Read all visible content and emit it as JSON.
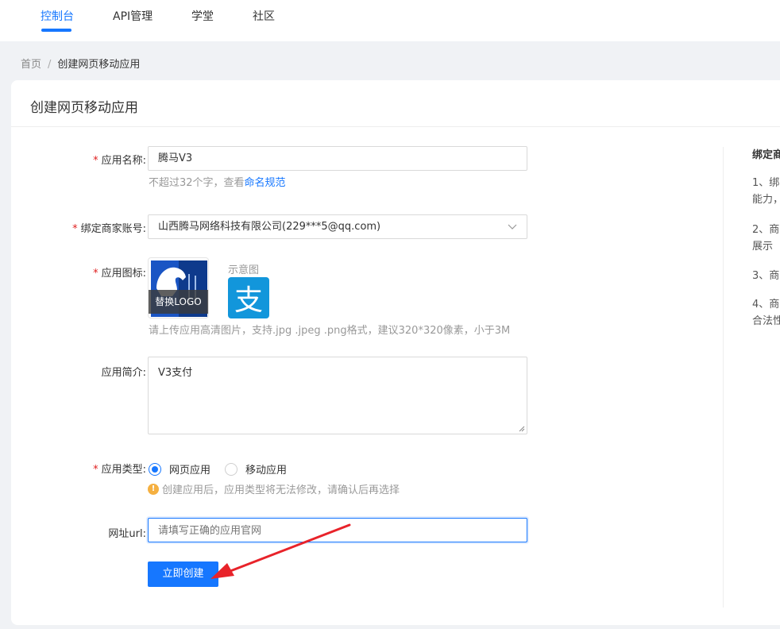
{
  "nav": {
    "items": [
      "控制台",
      "API管理",
      "学堂",
      "社区"
    ],
    "active_index": 0
  },
  "breadcrumb": {
    "home": "首页",
    "separator": "/",
    "current": "创建网页移动应用"
  },
  "page_title": "创建网页移动应用",
  "form": {
    "app_name": {
      "label": "应用名称:",
      "value": "腾马V3",
      "hint_prefix": "不超过32个字，查看",
      "hint_link": "命名规范"
    },
    "merchant": {
      "label": "绑定商家账号:",
      "value": "山西腾马网络科技有限公司(229***5@qq.com)"
    },
    "icon": {
      "label": "应用图标:",
      "replace_label": "替换LOGO",
      "sample_label": "示意图",
      "sample_glyph": "支",
      "hint": "请上传应用高清图片，支持.jpg .jpeg .png格式，建议320*320像素，小于3M"
    },
    "intro": {
      "label": "应用简介:",
      "value": "V3支付"
    },
    "type": {
      "label": "应用类型:",
      "options": [
        "网页应用",
        "移动应用"
      ],
      "selected": "网页应用",
      "warning_glyph": "!",
      "warning": "创建应用后，应用类型将无法修改，请确认后再选择"
    },
    "url": {
      "label": "网址url:",
      "placeholder": "请填写正确的应用官网",
      "value": ""
    },
    "submit_label": "立即创建"
  },
  "side_panel": {
    "title": "绑定商",
    "lines": [
      "1、绑",
      "能力，",
      "2、商",
      "展示",
      "3、商",
      "4、商",
      "合法性"
    ]
  },
  "colors": {
    "primary": "#1677ff",
    "required": "#e02020",
    "warning": "#f5b041",
    "annotation_arrow": "#e8232a"
  }
}
